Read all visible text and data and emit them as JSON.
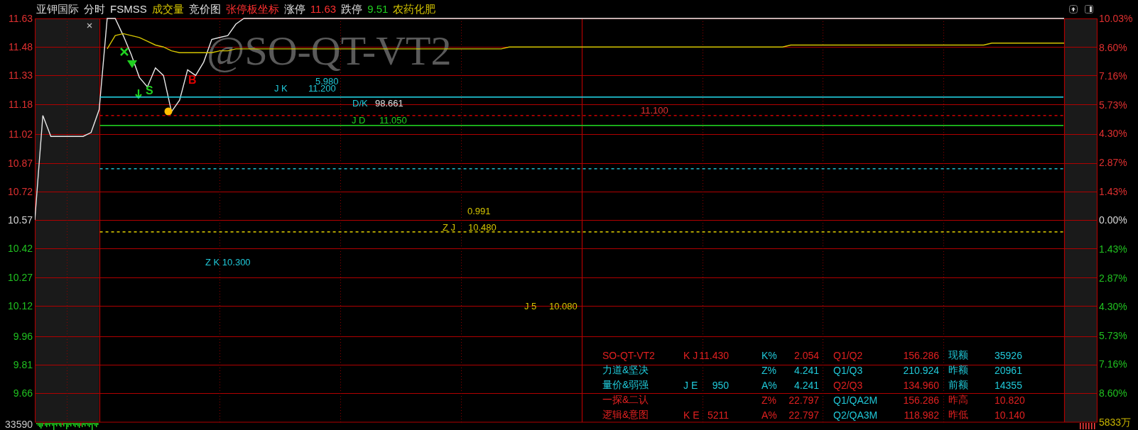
{
  "header": {
    "items": [
      {
        "text": "亚钾国际",
        "color": "#d0d0d0"
      },
      {
        "text": "分时",
        "color": "#e0e0e0"
      },
      {
        "text": "FSMSS",
        "color": "#e0e0e0"
      },
      {
        "text": "成交量",
        "color": "#d4c400"
      },
      {
        "text": "竞价图",
        "color": "#e0e0e0"
      },
      {
        "text": "张停板坐标",
        "color": "#ff3030"
      },
      {
        "text": "涨停",
        "color": "#e0e0e0"
      },
      {
        "text": "11.63",
        "color": "#ff3030"
      },
      {
        "text": "跌停",
        "color": "#e0e0e0"
      },
      {
        "text": "9.51",
        "color": "#20d020"
      },
      {
        "text": "农药化肥",
        "color": "#d4c400"
      }
    ]
  },
  "chart": {
    "overlay_label": "@SO-QT-VT2",
    "chart_data": {
      "type": "line",
      "categories": [
        null,
        null,
        null,
        null,
        null,
        null,
        null,
        null,
        null,
        null,
        null,
        null,
        null,
        null,
        null,
        null,
        null,
        null,
        null,
        null,
        null,
        null,
        null,
        null,
        null,
        null,
        null,
        null,
        null,
        null,
        null,
        null,
        null,
        null,
        null,
        null,
        null,
        null,
        null,
        null,
        null,
        null,
        null,
        null,
        null,
        null,
        null,
        null,
        null,
        null,
        null,
        null,
        null,
        null,
        null,
        null,
        null,
        null,
        null,
        null,
        null,
        null,
        null,
        null,
        null,
        null,
        null,
        null,
        null,
        null,
        null,
        null,
        null,
        null,
        null,
        null,
        null,
        null,
        null,
        null,
        null,
        null,
        null,
        null,
        null,
        null,
        null,
        null,
        null,
        null,
        null,
        null,
        null,
        null,
        null,
        null,
        null,
        null,
        null,
        null,
        null,
        null,
        null,
        null,
        null,
        null,
        null,
        null,
        null,
        null,
        null,
        null,
        null,
        null,
        null,
        null,
        null,
        null,
        null,
        null,
        null,
        null,
        null,
        null,
        null,
        null,
        null,
        null,
        null
      ],
      "series": [
        {
          "color": "#e8e8e8",
          "values": [
            10.57,
            11.12,
            11.01,
            11.01,
            11.01,
            11.01,
            11.01,
            11.03,
            11.15,
            11.63,
            11.63,
            11.54,
            11.44,
            11.32,
            11.27,
            11.37,
            11.33,
            11.14,
            11.2,
            11.36,
            11.33,
            11.4,
            11.52,
            11.53,
            11.54,
            11.6,
            11.63,
            11.63,
            11.63,
            11.63,
            11.63,
            11.63,
            11.63,
            11.63,
            11.63,
            11.63,
            11.63,
            11.63,
            11.63,
            11.63,
            11.63,
            11.63,
            11.63,
            11.63,
            11.63,
            11.63,
            11.63,
            11.63,
            11.63,
            11.63,
            11.63,
            11.63,
            11.63,
            11.63,
            11.63,
            11.63,
            11.63,
            11.63,
            11.63,
            11.63,
            11.63,
            11.63,
            11.63,
            11.63,
            11.63,
            11.63,
            11.63,
            11.63,
            11.63,
            11.63,
            11.63,
            11.63,
            11.63,
            11.63,
            11.63,
            11.63,
            11.63,
            11.63,
            11.63,
            11.63,
            11.63,
            11.63,
            11.63,
            11.63,
            11.63,
            11.63,
            11.63,
            11.63,
            11.63,
            11.63,
            11.63,
            11.63,
            11.63,
            11.63,
            11.63,
            11.63,
            11.63,
            11.63,
            11.63,
            11.63,
            11.63,
            11.63,
            11.63,
            11.63,
            11.63,
            11.63,
            11.63,
            11.63,
            11.63,
            11.63,
            11.63,
            11.63,
            11.63,
            11.63,
            11.63,
            11.63,
            11.63,
            11.63,
            11.63,
            11.63,
            11.63,
            11.63,
            11.63,
            11.63,
            11.63,
            11.63,
            11.63,
            11.63,
            11.63
          ]
        },
        {
          "color": "#d4c400",
          "values": [
            null,
            null,
            null,
            null,
            null,
            null,
            null,
            null,
            null,
            11.47,
            11.54,
            11.55,
            11.54,
            11.53,
            11.51,
            11.49,
            11.48,
            11.46,
            11.45,
            11.45,
            11.45,
            11.45,
            11.45,
            11.46,
            11.46,
            11.47,
            11.47,
            11.47,
            11.47,
            11.47,
            11.47,
            11.47,
            11.47,
            11.47,
            11.47,
            11.47,
            11.47,
            11.47,
            11.47,
            11.47,
            11.47,
            11.47,
            11.47,
            11.47,
            11.47,
            11.47,
            11.47,
            11.47,
            11.47,
            11.47,
            11.47,
            11.47,
            11.47,
            11.47,
            11.47,
            11.47,
            11.47,
            11.47,
            11.47,
            11.48,
            11.48,
            11.48,
            11.48,
            11.48,
            11.48,
            11.48,
            11.48,
            11.48,
            11.48,
            11.48,
            11.48,
            11.48,
            11.48,
            11.48,
            11.48,
            11.48,
            11.48,
            11.48,
            11.48,
            11.48,
            11.48,
            11.48,
            11.48,
            11.48,
            11.48,
            11.48,
            11.48,
            11.48,
            11.48,
            11.48,
            11.48,
            11.48,
            11.48,
            11.48,
            11.49,
            11.49,
            11.49,
            11.49,
            11.49,
            11.49,
            11.49,
            11.49,
            11.49,
            11.49,
            11.49,
            11.49,
            11.49,
            11.49,
            11.49,
            11.49,
            11.49,
            11.49,
            11.49,
            11.49,
            11.49,
            11.49,
            11.49,
            11.49,
            11.49,
            11.5,
            11.5,
            11.5,
            11.5,
            11.5,
            11.5,
            11.5,
            11.5,
            11.5,
            11.5
          ]
        }
      ],
      "ylim": [
        9.66,
        11.63
      ],
      "grid": true,
      "yticks": [
        {
          "value": 11.63,
          "label": "11.63"
        },
        {
          "value": 11.48,
          "label": "11.48"
        },
        {
          "value": 11.33,
          "label": "11.33"
        },
        {
          "value": 11.18,
          "label": "11.18"
        },
        {
          "value": 11.02,
          "label": "11.02"
        },
        {
          "value": 10.87,
          "label": "10.87"
        },
        {
          "value": 10.72,
          "label": "10.72"
        },
        {
          "value": 10.57,
          "label": "10.57"
        },
        {
          "value": 10.42,
          "label": "10.42"
        },
        {
          "value": 10.27,
          "label": "10.27"
        },
        {
          "value": 10.12,
          "label": "10.12"
        },
        {
          "value": 9.96,
          "label": "9.96"
        },
        {
          "value": 9.81,
          "label": "9.81"
        },
        {
          "value": 9.66,
          "label": "9.66"
        }
      ]
    },
    "percent_labels": [
      {
        "text": "10.03%",
        "color": "#e03030"
      },
      {
        "text": "8.60%",
        "color": "#e03030"
      },
      {
        "text": "7.16%",
        "color": "#e03030"
      },
      {
        "text": "5.73%",
        "color": "#e03030"
      },
      {
        "text": "4.30%",
        "color": "#e03030"
      },
      {
        "text": "2.87%",
        "color": "#e03030"
      },
      {
        "text": "1.43%",
        "color": "#e03030"
      },
      {
        "text": "0.00%",
        "color": "#d8d8d8"
      },
      {
        "text": "1.43%",
        "color": "#20c020"
      },
      {
        "text": "2.87%",
        "color": "#20c020"
      },
      {
        "text": "4.30%",
        "color": "#20c020"
      },
      {
        "text": "5.73%",
        "color": "#20c020"
      },
      {
        "text": "7.16%",
        "color": "#20c020"
      },
      {
        "text": "8.60%",
        "color": "#20c020"
      }
    ],
    "levels": [
      {
        "kind": "solid",
        "color": "#20d0e0"
      },
      {
        "kind": "dashed",
        "color": "#c00000"
      },
      {
        "kind": "solid",
        "color": "#20d020"
      },
      {
        "kind": "dashed",
        "color": "#20b0c0"
      },
      {
        "kind": "dashed",
        "color": "#d4c400"
      }
    ],
    "signals": [
      {
        "kind": "cross",
        "color": "#20d020"
      },
      {
        "kind": "down-triangle",
        "color": "#20d020"
      },
      {
        "kind": "sell",
        "text": "S",
        "color": "#20d020"
      },
      {
        "kind": "dot",
        "color": "#ffc000"
      },
      {
        "kind": "buy",
        "text": "B",
        "color": "#e00000"
      }
    ],
    "labels": [
      {
        "text": "5.980",
        "color": "#20c8d8"
      },
      {
        "text": "J K",
        "color": "#20c8d8"
      },
      {
        "text": "11.200",
        "color": "#20c8d8"
      },
      {
        "text": "D/K",
        "color": "#20c8d8"
      },
      {
        "text": "98.661",
        "color": "#e0e0e0"
      },
      {
        "text": "J D",
        "color": "#20d020"
      },
      {
        "text": "11.050",
        "color": "#20d020"
      },
      {
        "text": "11.100",
        "color": "#e03030"
      },
      {
        "text": "0.991",
        "color": "#d4c400"
      },
      {
        "text": "Z J",
        "color": "#d4c400"
      },
      {
        "text": "10.480",
        "color": "#d4c400"
      },
      {
        "text": "Z K 10.300",
        "color": "#20c8d8"
      },
      {
        "text": "J 5",
        "color": "#d4c400"
      },
      {
        "text": "10.080",
        "color": "#d4c400"
      }
    ],
    "volume": {
      "left_label": "33590",
      "right_label": "5833万"
    }
  },
  "table": {
    "rows": [
      {
        "cells": [
          {
            "text": "SO-QT-VT2",
            "color": "#e02020"
          },
          {
            "text": "K J",
            "color": "#e02020"
          },
          {
            "text": "11.430",
            "color": "#e02020"
          },
          {
            "text": "K%",
            "color": "#20c8d8"
          },
          {
            "text": "2.054",
            "color": "#e02020"
          },
          {
            "text": "Q1/Q2",
            "color": "#e02020"
          },
          {
            "text": "156.286",
            "color": "#e02020"
          },
          {
            "text": "现额",
            "color": "#20c8d8"
          },
          {
            "text": "35926",
            "color": "#20c8d8"
          }
        ]
      },
      {
        "cells": [
          {
            "text": "力道&坚决",
            "color": "#20c8d8"
          },
          null,
          null,
          {
            "text": "Z%",
            "color": "#20c8d8"
          },
          {
            "text": "4.241",
            "color": "#20c8d8"
          },
          {
            "text": "Q1/Q3",
            "color": "#20c8d8"
          },
          {
            "text": "210.924",
            "color": "#20c8d8"
          },
          {
            "text": "昨额",
            "color": "#20c8d8"
          },
          {
            "text": "20961",
            "color": "#20c8d8"
          }
        ]
      },
      {
        "cells": [
          {
            "text": "量价&弱强",
            "color": "#20c8d8"
          },
          {
            "text": "J E",
            "color": "#20c8d8"
          },
          {
            "text": "950",
            "color": "#20c8d8"
          },
          {
            "text": "A%",
            "color": "#20c8d8"
          },
          {
            "text": "4.241",
            "color": "#20c8d8"
          },
          {
            "text": "Q2/Q3",
            "color": "#e02020"
          },
          {
            "text": "134.960",
            "color": "#e02020"
          },
          {
            "text": "前额",
            "color": "#20c8d8"
          },
          {
            "text": "14355",
            "color": "#20c8d8"
          }
        ]
      },
      {
        "cells": [
          {
            "text": "一探&二认",
            "color": "#e02020"
          },
          null,
          null,
          {
            "text": "Z%",
            "color": "#e02020"
          },
          {
            "text": "22.797",
            "color": "#e02020"
          },
          {
            "text": "Q1/QA2M",
            "color": "#20c8d8"
          },
          {
            "text": "156.286",
            "color": "#e02020"
          },
          {
            "text": "昨高",
            "color": "#e02020"
          },
          {
            "text": "10.820",
            "color": "#e02020"
          }
        ]
      },
      {
        "cells": [
          {
            "text": "逻辑&意图",
            "color": "#e02020"
          },
          {
            "text": "K E",
            "color": "#e02020"
          },
          {
            "text": "5211",
            "color": "#e02020"
          },
          {
            "text": "A%",
            "color": "#e02020"
          },
          {
            "text": "22.797",
            "color": "#e02020"
          },
          {
            "text": "Q2/QA3M",
            "color": "#20c8d8"
          },
          {
            "text": "118.982",
            "color": "#e02020"
          },
          {
            "text": "昨低",
            "color": "#e02020"
          },
          {
            "text": "10.140",
            "color": "#e02020"
          }
        ]
      }
    ]
  }
}
